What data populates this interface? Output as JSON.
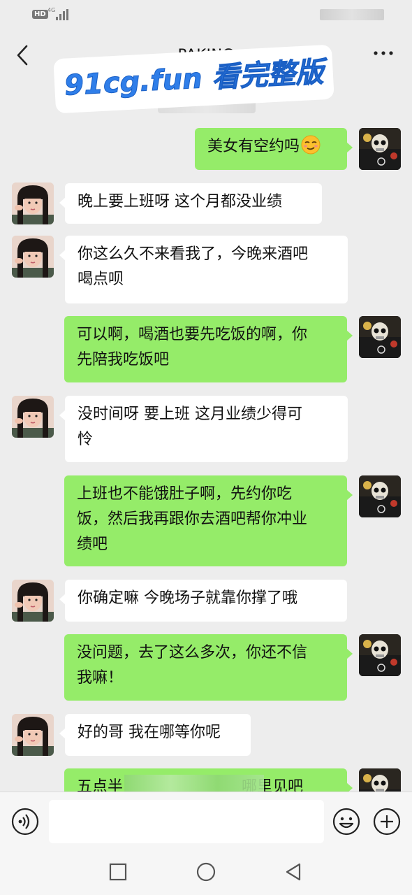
{
  "status_bar": {
    "hd": "HD",
    "network": "4G"
  },
  "nav": {
    "title": "PAKING"
  },
  "watermark": "91cg.fun 看完整版",
  "colors": {
    "outgoing_bubble": "#95ec69",
    "incoming_bubble": "#ffffff",
    "background": "#ededed"
  },
  "messages": [
    {
      "side": "out",
      "text": "美女有空约吗",
      "emoji": "smirk-emoji"
    },
    {
      "side": "in",
      "text": "晚上要上班呀 这个月都没业绩"
    },
    {
      "side": "in",
      "line1": "你这么久不来看我了，今晚来酒吧",
      "line2": "喝点呗"
    },
    {
      "side": "out",
      "line1": "可以啊，喝酒也要先吃饭的啊，你",
      "line2": "先陪我吃饭吧"
    },
    {
      "side": "in",
      "line1": "没时间呀 要上班 这月业绩少得可",
      "line2": "怜"
    },
    {
      "side": "out",
      "line1": "上班也不能饿肚子啊，先约你吃",
      "line2": "饭，然后我再跟你去酒吧帮你冲业",
      "line3": "绩吧"
    },
    {
      "side": "in",
      "text": "你确定嘛 今晚场子就靠你撑了哦"
    },
    {
      "side": "out",
      "line1": "没问题，去了这么多次，你还不信",
      "line2": "我嘛！"
    },
    {
      "side": "in",
      "text": "好的哥 我在哪等你呢"
    },
    {
      "side": "out",
      "start": "五点半",
      "end": "哪里见吧"
    }
  ],
  "input": {
    "placeholder": ""
  }
}
